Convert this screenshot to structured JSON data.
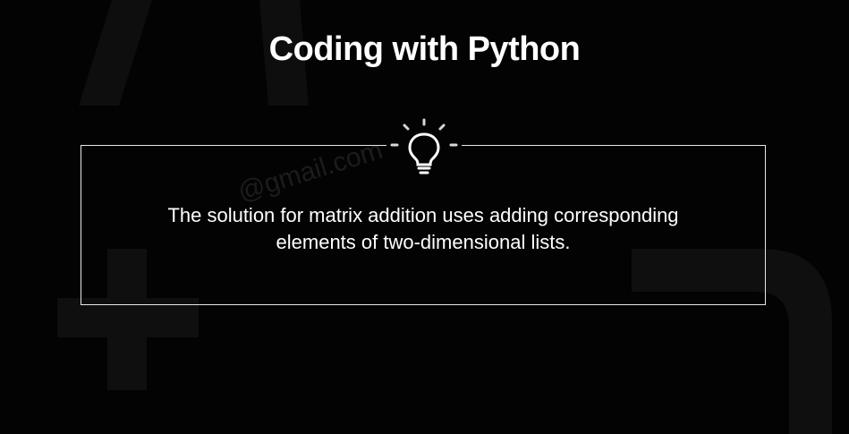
{
  "page": {
    "title": "Coding with Python"
  },
  "tip": {
    "icon": "lightbulb-icon",
    "line1": "The solution for matrix addition uses adding corresponding",
    "line2": "elements of two-dimensional lists."
  },
  "watermark": {
    "text": "@gmail.com"
  },
  "colors": {
    "background": "#030303",
    "text": "#ffffff",
    "border": "#e8e8e8",
    "decoration": "#101010"
  }
}
